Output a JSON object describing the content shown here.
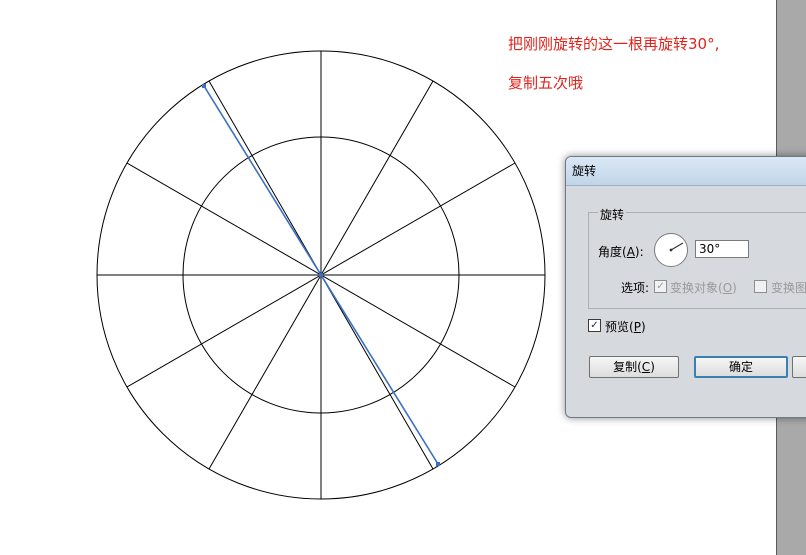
{
  "canvas": {
    "annotation": {
      "line1": "把刚刚旋转的这一根再旋转30°,",
      "line2": "复制五次哦"
    }
  },
  "dialog": {
    "title": "旋转",
    "group_label": "旋转",
    "angle_label_prefix": "角度(",
    "angle_label_key": "A",
    "angle_label_suffix": "):",
    "angle_value": "30°",
    "options_label": "选项:",
    "option_transform_objects": {
      "prefix": "变换对象(",
      "key": "O",
      "suffix": ")",
      "checked": true,
      "disabled": true
    },
    "option_transform_pattern": {
      "text": "变换图",
      "checked": false,
      "disabled": true
    },
    "preview": {
      "prefix": "预览(",
      "key": "P",
      "suffix": ")",
      "checked": true
    },
    "buttons": {
      "copy": {
        "prefix": "复制(",
        "key": "C",
        "suffix": ")"
      },
      "ok": "确定"
    }
  },
  "colors": {
    "annotation": "#e0241c",
    "selected_path": "#3a6fc4",
    "dialog_bg": "#d6d9dd",
    "default_button_border": "#3c7fb1"
  }
}
